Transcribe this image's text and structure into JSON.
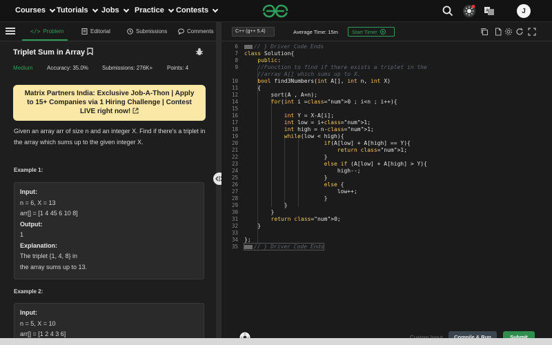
{
  "nav": {
    "items": [
      "Courses",
      "Tutorials",
      "Jobs",
      "Practice",
      "Contests"
    ],
    "avatar_initial": "J"
  },
  "tabs": {
    "problem": "Problem",
    "editorial": "Editorial",
    "submissions": "Submissions",
    "comments": "Comments"
  },
  "problem": {
    "title": "Triplet Sum in Array",
    "difficulty": "Medium",
    "accuracy": "Accuracy: 35.0%",
    "submissions": "Submissions: 276K+",
    "points": "Points: 4",
    "banner": "Matrix Partners India: Exclusive Job-A-Thon | Apply to 15+ Companies via 1 Hiring Challenge | Contest LIVE right now!",
    "description": "Given an array arr of size n and an integer X. Find if there's a triplet in the array which sums up to the given integer X.",
    "example1": {
      "title": "Example 1:",
      "input_label": "Input:",
      "input_line1": "n = 6, X = 13",
      "input_line2": "arr[] = [1 4 45 6 10 8]",
      "output_label": "Output:",
      "output": "1",
      "explanation_label": "Explanation:",
      "explanation_line1": "The triplet {1, 4, 8} in",
      "explanation_line2": "the array sums up to 13."
    },
    "example2": {
      "title": "Example 2:",
      "input_label": "Input:",
      "input_line1": "n = 5, X = 10",
      "input_line2": "arr[] = [1 2 4 3 6]"
    }
  },
  "editor": {
    "language": "C++ (g++ 5.4)",
    "avg_time": "Average Time: 15m",
    "start_timer": "Start Timer",
    "custom_input": "Custom Input",
    "compile_run": "Compile & Run",
    "submit": "Submit"
  },
  "code": [
    {
      "n": "6",
      "text": "// } Driver Code Ends",
      "type": "comment-fold"
    },
    {
      "n": "7",
      "text": "class Solution{",
      "type": "code"
    },
    {
      "n": "8",
      "text": "    public:",
      "type": "code"
    },
    {
      "n": "9",
      "text": "    //Function to find if there exists a triplet in the",
      "type": "comment"
    },
    {
      "n": "",
      "text": "    //array A[] which sums up to X.",
      "type": "comment"
    },
    {
      "n": "10",
      "text": "    bool find3Numbers(int A[], int n, int X)",
      "type": "code"
    },
    {
      "n": "11",
      "text": "    {",
      "type": "code"
    },
    {
      "n": "12",
      "text": "        sort(A , A+n);",
      "type": "code"
    },
    {
      "n": "14",
      "text": "        for(int i =0 ; i<n ; i++){",
      "type": "code"
    },
    {
      "n": "15",
      "text": "",
      "type": "code"
    },
    {
      "n": "16",
      "text": "            int Y = X-A[i];",
      "type": "code"
    },
    {
      "n": "17",
      "text": "            int low = i+1;",
      "type": "code"
    },
    {
      "n": "18",
      "text": "            int high = n-1;",
      "type": "code"
    },
    {
      "n": "19",
      "text": "            while(low < high){",
      "type": "code"
    },
    {
      "n": "20",
      "text": "                        if(A[low] + A[high] == Y){",
      "type": "code"
    },
    {
      "n": "21",
      "text": "                            return 1;",
      "type": "code"
    },
    {
      "n": "22",
      "text": "                        }",
      "type": "code"
    },
    {
      "n": "23",
      "text": "                        else if (A[low] + A[high] > Y){",
      "type": "code"
    },
    {
      "n": "24",
      "text": "                            high--;",
      "type": "code"
    },
    {
      "n": "25",
      "text": "                        }",
      "type": "code"
    },
    {
      "n": "26",
      "text": "                        else {",
      "type": "code"
    },
    {
      "n": "27",
      "text": "                            low++;",
      "type": "code"
    },
    {
      "n": "28",
      "text": "                        }",
      "type": "code"
    },
    {
      "n": "29",
      "text": "            }",
      "type": "code"
    },
    {
      "n": "30",
      "text": "        }",
      "type": "code"
    },
    {
      "n": "31",
      "text": "        return 0;",
      "type": "code"
    },
    {
      "n": "32",
      "text": "    }",
      "type": "code"
    },
    {
      "n": "33",
      "text": "",
      "type": "code"
    },
    {
      "n": "34",
      "text": "};",
      "type": "code"
    },
    {
      "n": "35",
      "text": "// } Driver Code Ends",
      "type": "comment-fold"
    }
  ],
  "colors": {
    "accent_green": "#2f9e5b",
    "banner_bg": "#fbe7a6",
    "keyword": "#f7c35b",
    "number": "#f38686"
  }
}
